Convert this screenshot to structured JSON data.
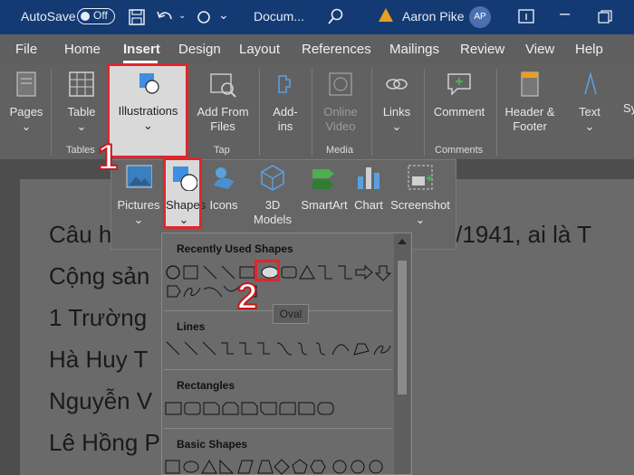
{
  "titlebar": {
    "autosave_label": "AutoSave",
    "autosave_state": "Off",
    "doc_name": "Docum...",
    "user_name": "Aaron Pike",
    "user_initials": "AP"
  },
  "menu": [
    "File",
    "Home",
    "Insert",
    "Design",
    "Layout",
    "References",
    "Mailings",
    "Review",
    "View",
    "Help"
  ],
  "menu_active": "Insert",
  "ribbon": {
    "pages": "Pages",
    "table": "Table",
    "illustrations": "Illustrations",
    "add_from_files_1": "Add From",
    "add_from_files_2": "Files",
    "addins_1": "Add-",
    "addins_2": "ins",
    "online_video_1": "Online",
    "online_video_2": "Video",
    "links": "Links",
    "comment": "Comment",
    "header_footer_1": "Header &",
    "header_footer_2": "Footer",
    "text": "Text",
    "sy": "Sy",
    "groups": {
      "tables": "Tables",
      "tap": "Tap",
      "media": "Media",
      "comments": "Comments"
    }
  },
  "illustrations_menu": {
    "pictures": "Pictures",
    "shapes": "Shapes",
    "icons": "Icons",
    "models_1": "3D",
    "models_2": "Models",
    "smartart": "SmartArt",
    "chart": "Chart",
    "screenshot": "Screenshot"
  },
  "shapes_gallery": {
    "recent": "Recently Used Shapes",
    "lines": "Lines",
    "rectangles": "Rectangles",
    "basic": "Basic Shapes",
    "tooltip": "Oval"
  },
  "document": {
    "lines": [
      "Câu h",
      "Cộng sản",
      "1  Trường",
      "Hà Huy T",
      "Nguyễn V",
      "Lê Hồng P"
    ],
    "right_fragment": "g 8/1941, ai là T"
  },
  "steps": {
    "one": "1",
    "two": "2"
  },
  "colors": {
    "highlight": "#e0262b",
    "titlebar": "#133a73"
  }
}
